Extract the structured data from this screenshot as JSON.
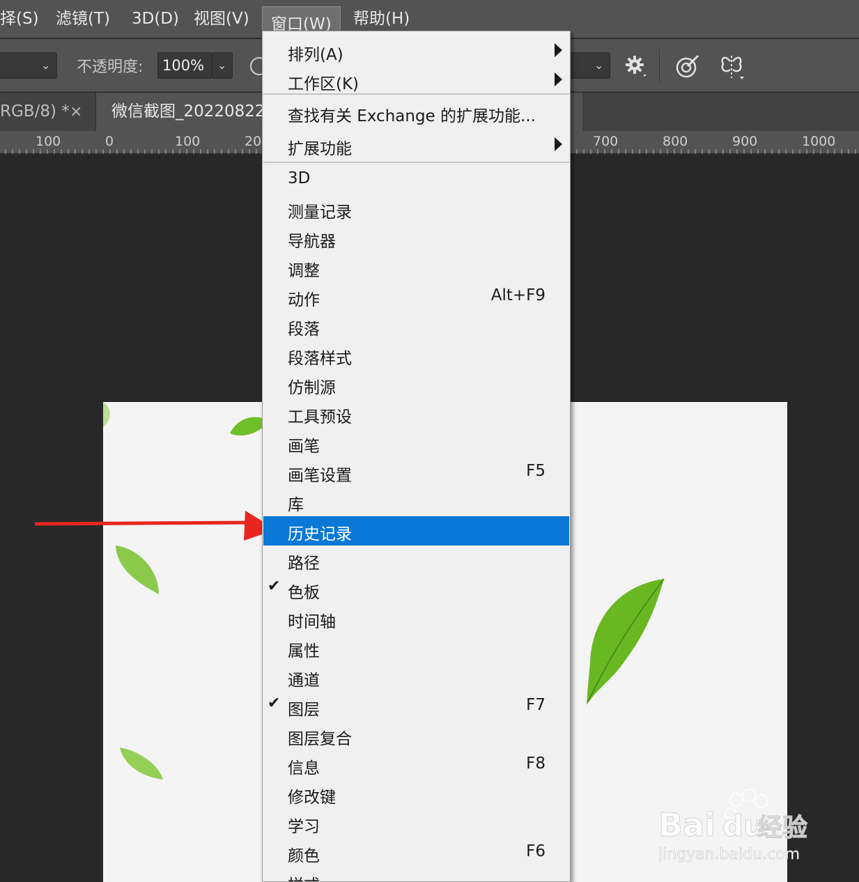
{
  "menubar": {
    "items": [
      "择(S)",
      "滤镜(T)",
      "3D(D)",
      "视图(V)",
      "窗口(W)",
      "帮助(H)"
    ]
  },
  "options": {
    "opacity_label": "不透明度:",
    "opacity_value": "100%"
  },
  "tabs": {
    "tab1_label": "RGB/8) *",
    "tab1_close": "×",
    "tab2_label": "微信截图_20220822"
  },
  "ruler": {
    "labels": [
      "100",
      "0",
      "100",
      "20",
      "700",
      "800",
      "900",
      "1000"
    ]
  },
  "menu": {
    "items": [
      {
        "label": "排列(A)",
        "shortcut": "",
        "submenu": true,
        "checked": false
      },
      {
        "label": "工作区(K)",
        "shortcut": "",
        "submenu": true,
        "checked": false
      },
      {
        "label": "查找有关 Exchange 的扩展功能...",
        "shortcut": "",
        "submenu": false,
        "checked": false
      },
      {
        "label": "扩展功能",
        "shortcut": "",
        "submenu": true,
        "checked": false
      },
      {
        "label": "3D",
        "shortcut": "",
        "submenu": false,
        "checked": false
      },
      {
        "label": "测量记录",
        "shortcut": "",
        "submenu": false,
        "checked": false
      },
      {
        "label": "导航器",
        "shortcut": "",
        "submenu": false,
        "checked": false
      },
      {
        "label": "调整",
        "shortcut": "",
        "submenu": false,
        "checked": false
      },
      {
        "label": "动作",
        "shortcut": "Alt+F9",
        "submenu": false,
        "checked": false
      },
      {
        "label": "段落",
        "shortcut": "",
        "submenu": false,
        "checked": false
      },
      {
        "label": "段落样式",
        "shortcut": "",
        "submenu": false,
        "checked": false
      },
      {
        "label": "仿制源",
        "shortcut": "",
        "submenu": false,
        "checked": false
      },
      {
        "label": "工具预设",
        "shortcut": "",
        "submenu": false,
        "checked": false
      },
      {
        "label": "画笔",
        "shortcut": "",
        "submenu": false,
        "checked": false
      },
      {
        "label": "画笔设置",
        "shortcut": "F5",
        "submenu": false,
        "checked": false
      },
      {
        "label": "库",
        "shortcut": "",
        "submenu": false,
        "checked": false
      },
      {
        "label": "历史记录",
        "shortcut": "",
        "submenu": false,
        "checked": false,
        "highlighted": true
      },
      {
        "label": "路径",
        "shortcut": "",
        "submenu": false,
        "checked": false
      },
      {
        "label": "色板",
        "shortcut": "",
        "submenu": false,
        "checked": true
      },
      {
        "label": "时间轴",
        "shortcut": "",
        "submenu": false,
        "checked": false
      },
      {
        "label": "属性",
        "shortcut": "",
        "submenu": false,
        "checked": false
      },
      {
        "label": "通道",
        "shortcut": "",
        "submenu": false,
        "checked": false
      },
      {
        "label": "图层",
        "shortcut": "F7",
        "submenu": false,
        "checked": true
      },
      {
        "label": "图层复合",
        "shortcut": "",
        "submenu": false,
        "checked": false
      },
      {
        "label": "信息",
        "shortcut": "F8",
        "submenu": false,
        "checked": false
      },
      {
        "label": "修改键",
        "shortcut": "",
        "submenu": false,
        "checked": false
      },
      {
        "label": "学习",
        "shortcut": "",
        "submenu": false,
        "checked": false
      },
      {
        "label": "颜色",
        "shortcut": "F6",
        "submenu": false,
        "checked": false
      },
      {
        "label": "样式",
        "shortcut": "",
        "submenu": false,
        "checked": false
      }
    ]
  },
  "watermark": {
    "brand": "Bai",
    "brand_du": "du",
    "brand_cn": "经验",
    "url": "jingyan.baidu.com"
  },
  "colors": {
    "highlight": "#0a78d7",
    "arrow": "#e8261f",
    "menu_bg": "#f0f0f0",
    "chrome": "#535353"
  }
}
